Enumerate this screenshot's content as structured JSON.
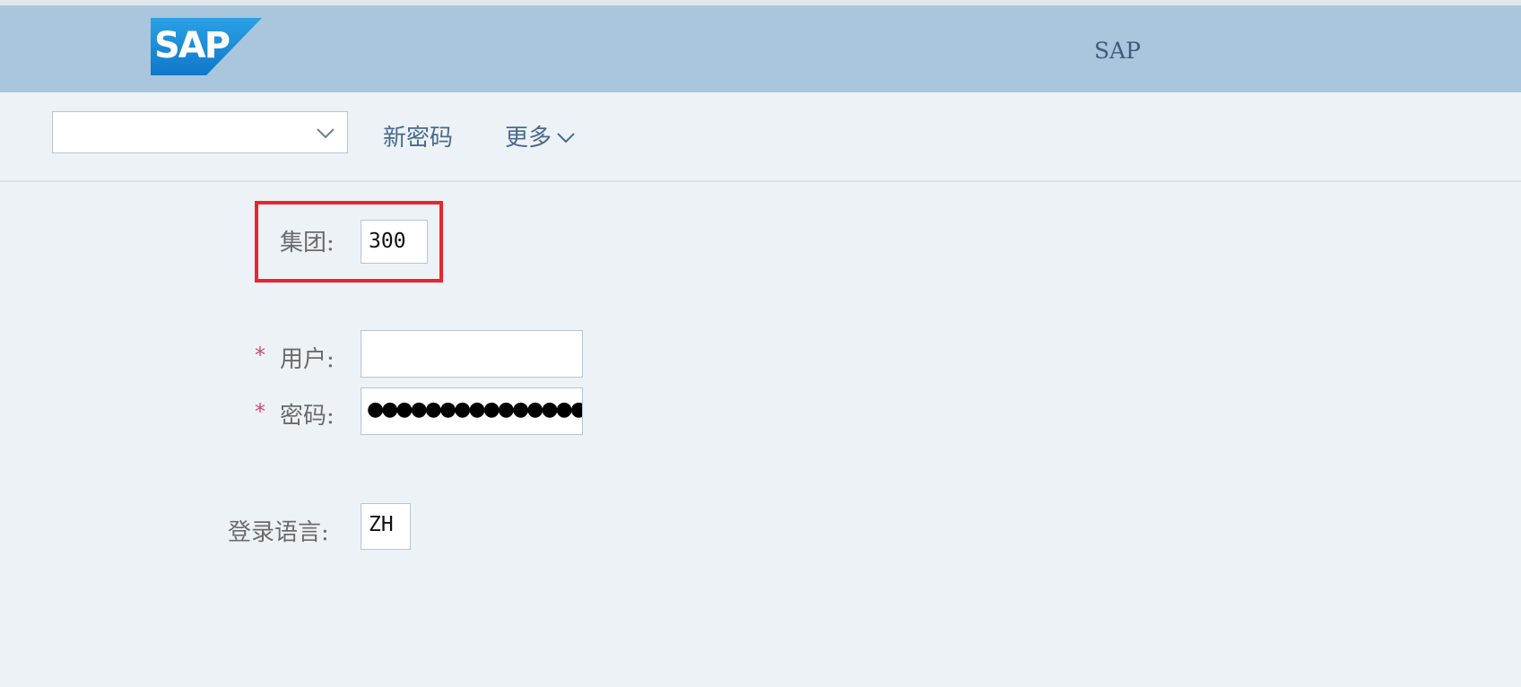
{
  "header": {
    "logo_text": "SAP",
    "title": "SAP"
  },
  "toolbar": {
    "client_dropdown_value": "",
    "new_password_label": "新密码",
    "more_label": "更多"
  },
  "form": {
    "client": {
      "label": "集团:",
      "value": "300"
    },
    "user": {
      "label": "用户:",
      "value": "",
      "required_marker": "*"
    },
    "password": {
      "label": "密码:",
      "value": "●●●●●●●●●●●●●●●●●●●",
      "required_marker": "*"
    },
    "language": {
      "label": "登录语言:",
      "value": "ZH"
    }
  },
  "colors": {
    "header_bg": "#a9c6dd",
    "page_bg": "#edf2f7",
    "highlight": "#e8262d",
    "required": "#d04a6b",
    "logo_blue": "#1b8fd8"
  },
  "icons": {
    "dropdown": "chevron-down-icon",
    "more": "chevron-down-icon"
  }
}
